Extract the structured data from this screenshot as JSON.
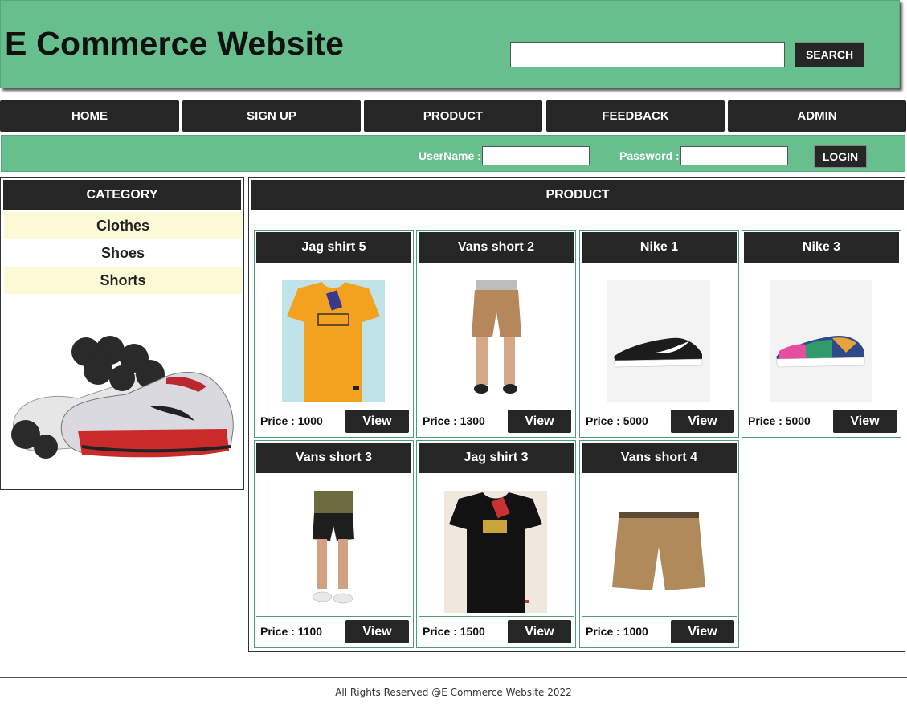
{
  "header": {
    "title": "E Commerce Website",
    "search_placeholder": "",
    "search_label": "SEARCH"
  },
  "nav": {
    "items": [
      "HOME",
      "SIGN UP",
      "PRODUCT",
      "FEEDBACK",
      "ADMIN"
    ]
  },
  "login": {
    "username_label": "UserName :",
    "password_label": "Password :",
    "username_value": "",
    "password_value": "",
    "button_label": "LOGIN"
  },
  "sidebar": {
    "title": "CATEGORY",
    "categories": [
      "Clothes",
      "Shoes",
      "Shorts"
    ]
  },
  "main": {
    "title": "PRODUCT",
    "view_label": "View",
    "products": [
      {
        "name": "Jag shirt 5",
        "price": "Price : 1000",
        "image": "orange-tshirt"
      },
      {
        "name": "Vans short 2",
        "price": "Price : 1300",
        "image": "khaki-shorts-model"
      },
      {
        "name": "Nike 1",
        "price": "Price : 5000",
        "image": "black-sneaker"
      },
      {
        "name": "Nike 3",
        "price": "Price : 5000",
        "image": "color-sneaker"
      },
      {
        "name": "Vans short 3",
        "price": "Price : 1100",
        "image": "black-shorts-model"
      },
      {
        "name": "Jag shirt 3",
        "price": "Price : 1500",
        "image": "black-tshirt"
      },
      {
        "name": "Vans short 4",
        "price": "Price : 1000",
        "image": "tan-shorts"
      }
    ]
  },
  "footer": {
    "text": "All Rights Reserved @E Commerce Website 2022"
  },
  "colors": {
    "header_green": "#66bf8c",
    "dark": "#262626",
    "category_highlight": "#fcf9d6",
    "card_border": "#4f9e73"
  }
}
